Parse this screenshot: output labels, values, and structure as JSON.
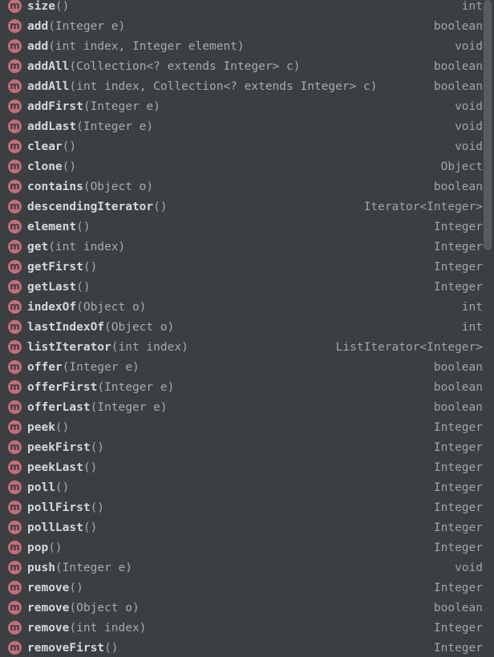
{
  "colors": {
    "background": "#3c3f41",
    "method_badge": "#c56e78",
    "name_text": "#d6d8db",
    "param_text": "#a8aaad",
    "type_text": "#a1a3a6",
    "scroll_thumb": "#595b5d"
  },
  "badge_letter": "m",
  "items": [
    {
      "name": "size",
      "params": "()",
      "type": "int"
    },
    {
      "name": "add",
      "params": "(Integer e)",
      "type": "boolean"
    },
    {
      "name": "add",
      "params": "(int index, Integer element)",
      "type": "void"
    },
    {
      "name": "addAll",
      "params": "(Collection<? extends Integer> c)",
      "type": "boolean"
    },
    {
      "name": "addAll",
      "params": "(int index, Collection<? extends Integer> c)",
      "type": "boolean"
    },
    {
      "name": "addFirst",
      "params": "(Integer e)",
      "type": "void"
    },
    {
      "name": "addLast",
      "params": "(Integer e)",
      "type": "void"
    },
    {
      "name": "clear",
      "params": "()",
      "type": "void"
    },
    {
      "name": "clone",
      "params": "()",
      "type": "Object"
    },
    {
      "name": "contains",
      "params": "(Object o)",
      "type": "boolean"
    },
    {
      "name": "descendingIterator",
      "params": "()",
      "type": "Iterator<Integer>"
    },
    {
      "name": "element",
      "params": "()",
      "type": "Integer"
    },
    {
      "name": "get",
      "params": "(int index)",
      "type": "Integer"
    },
    {
      "name": "getFirst",
      "params": "()",
      "type": "Integer"
    },
    {
      "name": "getLast",
      "params": "()",
      "type": "Integer"
    },
    {
      "name": "indexOf",
      "params": "(Object o)",
      "type": "int"
    },
    {
      "name": "lastIndexOf",
      "params": "(Object o)",
      "type": "int"
    },
    {
      "name": "listIterator",
      "params": "(int index)",
      "type": "ListIterator<Integer>"
    },
    {
      "name": "offer",
      "params": "(Integer e)",
      "type": "boolean"
    },
    {
      "name": "offerFirst",
      "params": "(Integer e)",
      "type": "boolean"
    },
    {
      "name": "offerLast",
      "params": "(Integer e)",
      "type": "boolean"
    },
    {
      "name": "peek",
      "params": "()",
      "type": "Integer"
    },
    {
      "name": "peekFirst",
      "params": "()",
      "type": "Integer"
    },
    {
      "name": "peekLast",
      "params": "()",
      "type": "Integer"
    },
    {
      "name": "poll",
      "params": "()",
      "type": "Integer"
    },
    {
      "name": "pollFirst",
      "params": "()",
      "type": "Integer"
    },
    {
      "name": "pollLast",
      "params": "()",
      "type": "Integer"
    },
    {
      "name": "pop",
      "params": "()",
      "type": "Integer"
    },
    {
      "name": "push",
      "params": "(Integer e)",
      "type": "void"
    },
    {
      "name": "remove",
      "params": "()",
      "type": "Integer"
    },
    {
      "name": "remove",
      "params": "(Object o)",
      "type": "boolean"
    },
    {
      "name": "remove",
      "params": "(int index)",
      "type": "Integer"
    },
    {
      "name": "removeFirst",
      "params": "()",
      "type": "Integer"
    }
  ]
}
